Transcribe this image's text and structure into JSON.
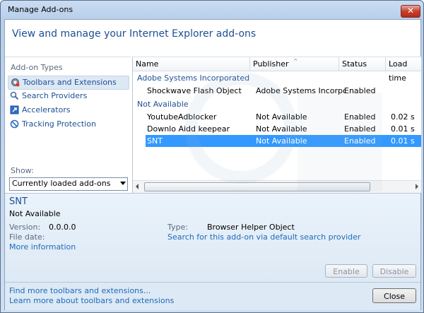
{
  "window": {
    "title": "Manage Add-ons"
  },
  "header": {
    "text": "View and manage your Internet Explorer add-ons"
  },
  "sidebar": {
    "section_label": "Add-on Types",
    "items": [
      {
        "label": "Toolbars and Extensions",
        "icon": "gear-icon",
        "selected": true
      },
      {
        "label": "Search Providers",
        "icon": "search-icon",
        "selected": false
      },
      {
        "label": "Accelerators",
        "icon": "accelerator-icon",
        "selected": false
      },
      {
        "label": "Tracking Protection",
        "icon": "block-icon",
        "selected": false
      }
    ],
    "show_label": "Show:",
    "show_value": "Currently loaded add-ons"
  },
  "list": {
    "columns": [
      "Name",
      "Publisher",
      "Status",
      "Load time"
    ],
    "groups": [
      {
        "label": "Adobe Systems Incorporated",
        "rows": [
          {
            "name": "Shockwave Flash Object",
            "publisher": "Adobe Systems Incorpor...",
            "status": "Enabled",
            "load_time": ""
          }
        ]
      },
      {
        "label": "Not Available",
        "rows": [
          {
            "name": "YoutubeAdblocker",
            "publisher": "Not Available",
            "status": "Enabled",
            "load_time": "0.02 s"
          },
          {
            "name": "Downlo Aidd keepear",
            "publisher": "Not Available",
            "status": "Enabled",
            "load_time": "0.01 s"
          },
          {
            "name": "SNT",
            "publisher": "Not Available",
            "status": "Enabled",
            "load_time": "0.01 s",
            "selected": true
          }
        ]
      }
    ]
  },
  "details": {
    "name": "SNT",
    "publisher": "Not Available",
    "version_label": "Version:",
    "version": "0.0.0.0",
    "file_date_label": "File date:",
    "file_date": "",
    "more_info": "More information",
    "type_label": "Type:",
    "type": "Browser Helper Object",
    "search_link": "Search for this add-on via default search provider",
    "enable_label": "Enable",
    "disable_label": "Disable"
  },
  "footer": {
    "link1": "Find more toolbars and extensions...",
    "link2": "Learn more about toolbars and extensions",
    "close_label": "Close"
  },
  "colors": {
    "accent_blue": "#1e4f93",
    "selection": "#3399ff",
    "link": "#1e6bb8"
  }
}
